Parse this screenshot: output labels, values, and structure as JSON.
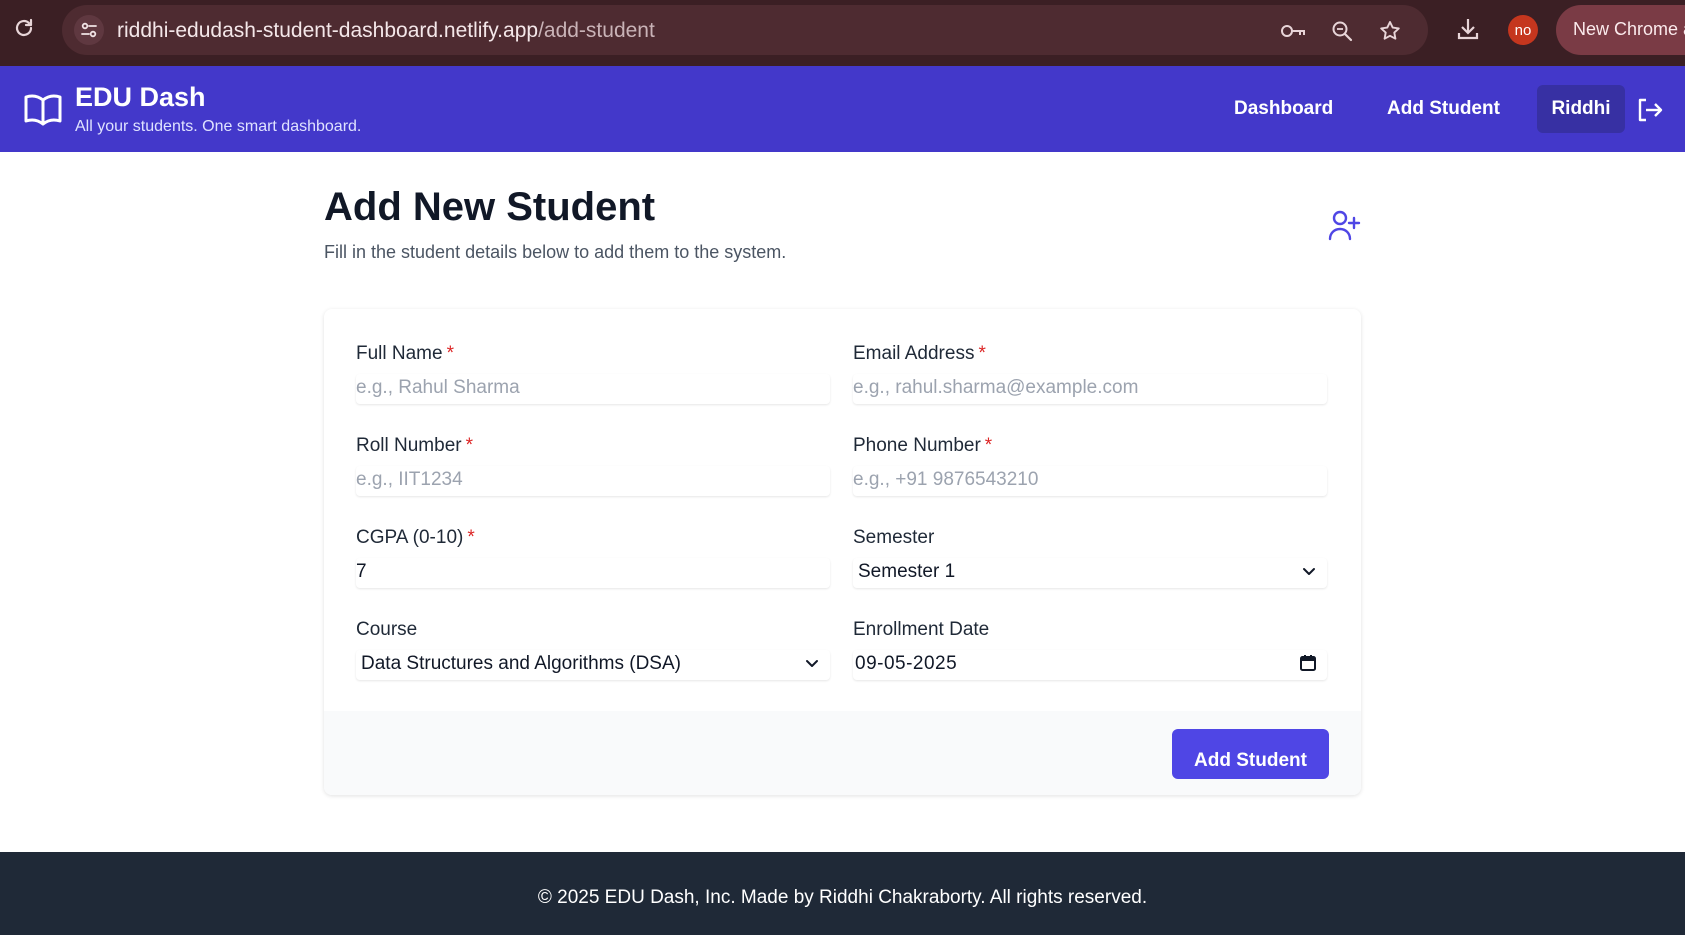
{
  "browser": {
    "url_host": "riddhi-edudash-student-dashboard.netlify.app",
    "url_path": "/add-student",
    "profile_initials": "no",
    "new_chrome_label": "New Chrome a"
  },
  "header": {
    "brand_title": "EDU Dash",
    "brand_subtitle": "All your students. One smart dashboard.",
    "nav": {
      "dashboard": "Dashboard",
      "add_student": "Add Student"
    },
    "user_name": "Riddhi",
    "colors": {
      "header_bg": "#4338ca",
      "user_pill_bg": "#3730a3"
    }
  },
  "page": {
    "title": "Add New Student",
    "subtitle": "Fill in the student details below to add them to the system."
  },
  "form": {
    "required_marker": "*",
    "full_name": {
      "label": "Full Name",
      "placeholder": "e.g., Rahul Sharma"
    },
    "email": {
      "label": "Email Address",
      "placeholder": "e.g., rahul.sharma@example.com"
    },
    "roll_number": {
      "label": "Roll Number",
      "placeholder": "e.g., IIT1234"
    },
    "phone": {
      "label": "Phone Number",
      "placeholder": "e.g., +91 9876543210"
    },
    "cgpa": {
      "label": "CGPA (0-10)",
      "value": "7"
    },
    "semester": {
      "label": "Semester",
      "value": "Semester 1"
    },
    "course": {
      "label": "Course",
      "value": "Data Structures and Algorithms (DSA)"
    },
    "enrollment_date": {
      "label": "Enrollment Date",
      "value": "09-05-2025"
    },
    "submit_label": "Add Student",
    "colors": {
      "submit_bg": "#4f46e5",
      "required": "#dc2626"
    }
  },
  "footer": {
    "text": "© 2025 EDU Dash, Inc. Made by Riddhi Chakraborty. All rights reserved."
  }
}
